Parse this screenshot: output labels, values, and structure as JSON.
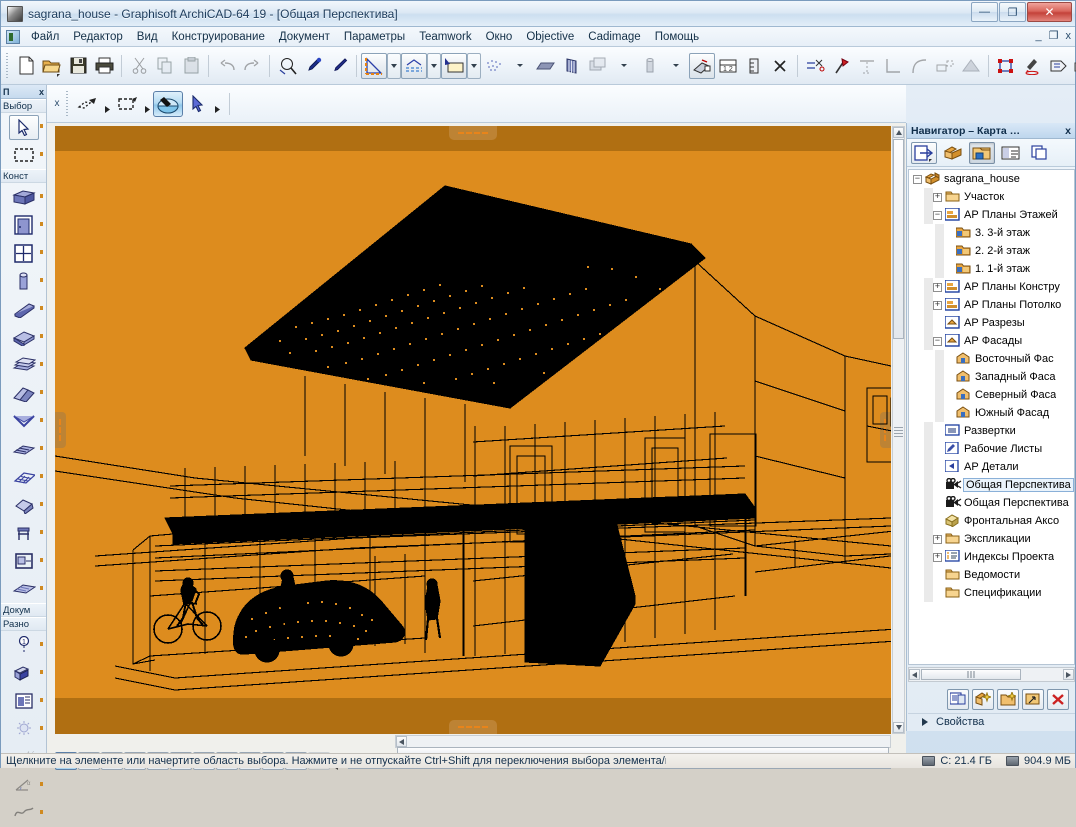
{
  "window": {
    "title": "sagrana_house - Graphisoft ArchiCAD-64 19 - [Общая Перспектива]",
    "minimize": "—",
    "maximize": "❐",
    "close": "✕",
    "inner_minimize": "_",
    "inner_restore": "❐",
    "inner_close": "x"
  },
  "menu": {
    "items": [
      {
        "label": "Файл"
      },
      {
        "label": "Редактор"
      },
      {
        "label": "Вид"
      },
      {
        "label": "Конструирование"
      },
      {
        "label": "Документ"
      },
      {
        "label": "Параметры"
      },
      {
        "label": "Teamwork"
      },
      {
        "label": "Окно"
      },
      {
        "label": "Objective"
      },
      {
        "label": "Cadimage"
      },
      {
        "label": "Помощь"
      }
    ]
  },
  "main_toolbar": {
    "buttons": [
      {
        "name": "new-file-button"
      },
      {
        "name": "open-file-button"
      },
      {
        "name": "save-file-button"
      },
      {
        "name": "print-button"
      },
      {
        "name": "cut-button"
      },
      {
        "name": "copy-button"
      },
      {
        "name": "paste-button"
      },
      {
        "name": "undo-button"
      },
      {
        "name": "redo-button"
      },
      {
        "name": "find-select-button"
      },
      {
        "name": "eyedropper-button"
      },
      {
        "name": "syringe-button"
      },
      {
        "name": "marquee-tool-button"
      },
      {
        "name": "elevation-tool-button"
      },
      {
        "name": "layer-tool-button"
      },
      {
        "name": "mesh-points-button"
      },
      {
        "name": "slab-display-button"
      },
      {
        "name": "wall-display-button"
      },
      {
        "name": "stories-button"
      },
      {
        "name": "column-button"
      },
      {
        "name": "trace-reference-button"
      },
      {
        "name": "dimension-button"
      },
      {
        "name": "units-button"
      },
      {
        "name": "scissors-button"
      },
      {
        "name": "axe-button"
      },
      {
        "name": "mirror-button"
      },
      {
        "name": "corner-button"
      },
      {
        "name": "curve-button"
      },
      {
        "name": "adjust-button"
      },
      {
        "name": "roof-button"
      },
      {
        "name": "selection-frame-button"
      },
      {
        "name": "marker-button"
      },
      {
        "name": "label-button"
      },
      {
        "name": "render-button"
      },
      {
        "name": "globe-button"
      }
    ]
  },
  "toolbox": {
    "header": "П",
    "close": "x",
    "section_select": "Выбор",
    "section_construct": "Конст",
    "section_document": "Докум",
    "section_misc": "Разно",
    "items": [
      {
        "name": "arrow-tool",
        "selected": true
      },
      {
        "name": "marquee-tool",
        "selected": false
      },
      {
        "name": "wall-tool",
        "selected": false
      },
      {
        "name": "door-tool",
        "selected": false
      },
      {
        "name": "window-tool",
        "selected": false
      },
      {
        "name": "column-tool",
        "selected": false
      },
      {
        "name": "beam-tool",
        "selected": false
      },
      {
        "name": "slab-tool",
        "selected": false
      },
      {
        "name": "stair-tool",
        "selected": false
      },
      {
        "name": "roof-tool",
        "selected": false
      },
      {
        "name": "shell-tool",
        "selected": false
      },
      {
        "name": "mesh-tool",
        "selected": false
      },
      {
        "name": "curtain-wall-tool",
        "selected": false
      },
      {
        "name": "morph-tool",
        "selected": false
      },
      {
        "name": "object-tool",
        "selected": false
      },
      {
        "name": "zone-tool",
        "selected": false
      },
      {
        "name": "roofplane-tool",
        "selected": false
      },
      {
        "name": "dimension-tool",
        "selected": false
      },
      {
        "name": "section-tool",
        "selected": false
      },
      {
        "name": "elevation-tool",
        "selected": false
      },
      {
        "name": "light-tool",
        "selected": false
      },
      {
        "name": "spline-tool",
        "selected": false
      },
      {
        "name": "angle-tool",
        "selected": false
      },
      {
        "name": "curve-tool",
        "selected": false
      }
    ]
  },
  "secondary_toolbar": {
    "close": "x",
    "buttons": [
      {
        "name": "edit-marquee-button"
      },
      {
        "name": "rect-select-button"
      },
      {
        "name": "fill-paint-button",
        "active": true
      },
      {
        "name": "arrow-select-button"
      }
    ]
  },
  "zoom_toolbar": {
    "buttons": [
      {
        "name": "view-3d-button",
        "active": true
      },
      {
        "name": "zoom-preview-button",
        "active": false
      },
      {
        "name": "zoom-fit-button",
        "active": false
      },
      {
        "name": "zoom-scale-button",
        "active": false
      },
      {
        "name": "zoom-in-button",
        "active": false
      },
      {
        "name": "zoom-out-button",
        "active": false
      },
      {
        "name": "pan-hand-button",
        "active": false
      },
      {
        "name": "orbit-button",
        "active": false
      },
      {
        "name": "walk-button",
        "active": false
      },
      {
        "name": "zoom-area-button",
        "active": false
      },
      {
        "name": "zoom-previous-button",
        "active": false
      },
      {
        "name": "zoom-next-button",
        "active": false,
        "disabled": true
      }
    ]
  },
  "navigator": {
    "title": "Навигатор – Карта …",
    "close": "x",
    "toolbar_buttons": [
      {
        "name": "navigator-open-button",
        "state": "framed"
      },
      {
        "name": "project-chooser-button",
        "state": "normal"
      },
      {
        "name": "view-map-button",
        "state": "pressed"
      },
      {
        "name": "layout-book-button",
        "state": "normal"
      },
      {
        "name": "publisher-button",
        "state": "normal"
      }
    ],
    "tree": [
      {
        "label": "sagrana_house",
        "depth": 0,
        "expander": "minus",
        "icon": "project-icon"
      },
      {
        "label": "Участок",
        "depth": 1,
        "expander": "plus",
        "icon": "folder-icon"
      },
      {
        "label": "АР Планы Этажей",
        "depth": 1,
        "expander": "minus",
        "icon": "floorplan-group-icon"
      },
      {
        "label": "3. 3-й этаж",
        "depth": 2,
        "expander": "none",
        "icon": "floorplan-icon"
      },
      {
        "label": "2. 2-й этаж",
        "depth": 2,
        "expander": "none",
        "icon": "floorplan-icon"
      },
      {
        "label": "1. 1-й этаж",
        "depth": 2,
        "expander": "none",
        "icon": "floorplan-icon"
      },
      {
        "label": "АР Планы Констру",
        "depth": 1,
        "expander": "plus",
        "icon": "floorplan-group-icon"
      },
      {
        "label": "АР Планы Потолко",
        "depth": 1,
        "expander": "plus",
        "icon": "floorplan-group-icon"
      },
      {
        "label": "АР Разрезы",
        "depth": 1,
        "expander": "none",
        "icon": "section-group-icon"
      },
      {
        "label": "АР Фасады",
        "depth": 1,
        "expander": "minus",
        "icon": "section-group-icon"
      },
      {
        "label": "Восточный Фас",
        "depth": 2,
        "expander": "none",
        "icon": "elevation-icon"
      },
      {
        "label": "Западный Фаса",
        "depth": 2,
        "expander": "none",
        "icon": "elevation-icon"
      },
      {
        "label": "Северный Фаса",
        "depth": 2,
        "expander": "none",
        "icon": "elevation-icon"
      },
      {
        "label": "Южный Фасад",
        "depth": 2,
        "expander": "none",
        "icon": "elevation-icon"
      },
      {
        "label": "Развертки",
        "depth": 1,
        "expander": "none",
        "icon": "interior-elevation-icon"
      },
      {
        "label": "Рабочие Листы",
        "depth": 1,
        "expander": "none",
        "icon": "worksheet-icon"
      },
      {
        "label": "АР Детали",
        "depth": 1,
        "expander": "none",
        "icon": "detail-icon"
      },
      {
        "label": "Общая Перспектива",
        "depth": 1,
        "expander": "none",
        "icon": "camera-icon",
        "selected": true
      },
      {
        "label": "Общая Перспектива",
        "depth": 1,
        "expander": "none",
        "icon": "camera-icon"
      },
      {
        "label": "Фронтальная Аксо",
        "depth": 1,
        "expander": "none",
        "icon": "axonometry-icon"
      },
      {
        "label": "Экспликации",
        "depth": 1,
        "expander": "plus",
        "icon": "folder-icon"
      },
      {
        "label": "Индексы Проекта",
        "depth": 1,
        "expander": "plus",
        "icon": "index-icon"
      },
      {
        "label": "Ведомости",
        "depth": 1,
        "expander": "none",
        "icon": "folder-icon"
      },
      {
        "label": "Спецификации",
        "depth": 1,
        "expander": "none",
        "icon": "folder-icon"
      }
    ],
    "footer_buttons": [
      {
        "name": "settings-button"
      },
      {
        "name": "new-view-button"
      },
      {
        "name": "new-folder-button"
      },
      {
        "name": "open-view-button"
      },
      {
        "name": "delete-view-button"
      }
    ],
    "properties_label": "Свойства"
  },
  "status_bar": {
    "hint": "Щелкните на элементе или начертите область выбора. Нажмите и не отпускайте Ctrl+Shift для переключения выбора элемента/под",
    "disk": "C: 21.4 ГБ",
    "memory": "904.9 МБ"
  },
  "viewport": {
    "background_color": "#dd8c1e",
    "band_color": "#b06f12",
    "wireframe_color": "#000000"
  }
}
